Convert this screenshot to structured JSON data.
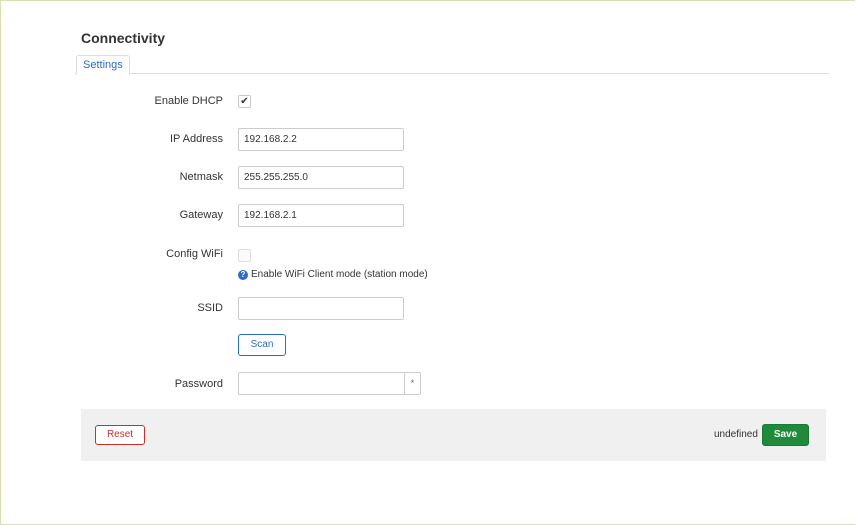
{
  "page": {
    "title": "Connectivity"
  },
  "tabs": [
    {
      "label": "Settings",
      "active": true
    }
  ],
  "form": {
    "enable_dhcp": {
      "label": "Enable DHCP",
      "checked": true,
      "check_glyph": "✔"
    },
    "ip_address": {
      "label": "IP Address",
      "value": "192.168.2.2"
    },
    "netmask": {
      "label": "Netmask",
      "value": "255.255.255.0"
    },
    "gateway": {
      "label": "Gateway",
      "value": "192.168.2.1"
    },
    "config_wifi": {
      "label": "Config WiFi",
      "checked": false,
      "help_icon": "?",
      "hint": "Enable WiFi Client mode (station mode)"
    },
    "ssid": {
      "label": "SSID",
      "value": ""
    },
    "scan_button": {
      "label": "Scan"
    },
    "password": {
      "label": "Password",
      "value": "",
      "toggle_label": "*"
    }
  },
  "actions": {
    "reset_label": "Reset",
    "status_text": "undefined",
    "save_label": "Save"
  },
  "colors": {
    "accent": "#2b6cc4",
    "save": "#1e8a3a",
    "reset": "#c9302c",
    "footer_bg": "#f0f0f0"
  }
}
